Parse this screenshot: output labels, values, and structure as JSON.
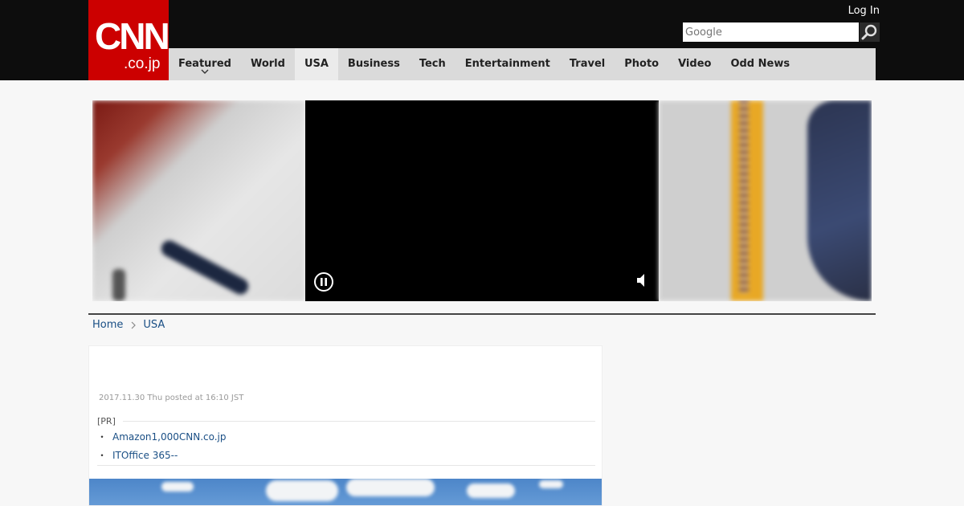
{
  "header": {
    "logo": {
      "main": "CNN",
      "sub": ".co.jp"
    },
    "login_label": "Log In",
    "search": {
      "placeholder": "Google"
    },
    "nav": [
      {
        "label": "Featured",
        "has_dropdown": true
      },
      {
        "label": "World"
      },
      {
        "label": "USA",
        "active": true
      },
      {
        "label": "Business"
      },
      {
        "label": "Tech"
      },
      {
        "label": "Entertainment"
      },
      {
        "label": "Travel"
      },
      {
        "label": "Photo"
      },
      {
        "label": "Video"
      },
      {
        "label": "Odd News"
      }
    ]
  },
  "breadcrumb": [
    {
      "label": "Home"
    },
    {
      "label": "USA"
    }
  ],
  "article": {
    "date": "2017.11.30 Thu posted at 16:10 JST",
    "pr_label": "[PR]",
    "pr_links": [
      {
        "label": "Amazon1,000CNN.co.jp"
      },
      {
        "label": "ITOffice 365--"
      }
    ]
  },
  "colors": {
    "brand_red": "#cc0000",
    "link": "#1a4f85",
    "header_bg": "#0d0d0d",
    "nav_bg": "#dadada"
  },
  "icons": [
    "search-icon",
    "chevron-down-icon",
    "pause-icon",
    "volume-icon",
    "chevron-right-icon"
  ]
}
